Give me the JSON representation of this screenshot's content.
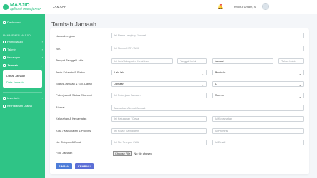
{
  "brand": {
    "name": "MASJID",
    "subtitle": "aplikasi manajemen"
  },
  "sidebar": {
    "dashboard": "Dashboard",
    "section_label": "MANAJEMEN MASJID",
    "items": [
      {
        "label": "Profil Masjid"
      },
      {
        "label": "Takmir"
      },
      {
        "label": "Keuangan"
      },
      {
        "label": "Jamaah"
      }
    ],
    "submenu": [
      {
        "label": "Daftar Jamaah"
      },
      {
        "label": "Data Jamaah"
      }
    ],
    "bottom_items": [
      {
        "label": "Inventaris"
      },
      {
        "label": "Ke Halaman Utama"
      }
    ]
  },
  "topbar": {
    "title": "JAMAAH",
    "user": "Khoirul Umam, S."
  },
  "page": {
    "title": "Tambah Jamaah"
  },
  "form": {
    "nama_label": "Nama Lengkap",
    "nama_placeholder": "Isi Nama Lengkap Jamaah",
    "nik_label": "NIK",
    "nik_placeholder": "Isi Nomor KTP / NIK",
    "ttl_label": "Tempat Tanggal Lahir",
    "ttl_tempat_placeholder": "Isi Kab/Kabupaten Kelahiran",
    "ttl_tanggal_placeholder": "Tanggal Lahir",
    "ttl_bulan_value": "Januari",
    "ttl_tahun_placeholder": "Tahun Lahir",
    "jk_label": "Jenis Kelamin & Status",
    "jk_value": "Laki-laki",
    "status_value": "Menikah",
    "sj_label": "Status Jamaah & Gol. Darah",
    "sj_value": "Jamaah",
    "darah_value": "A",
    "pek_label": "Pekerjaan & Status Ekonomi",
    "pek_placeholder": "Isi Pekerjaan Jamaah",
    "ekonomi_value": "Mampu",
    "alamat_label": "Alamat",
    "alamat_placeholder": "Masukkan Alamat Jamaah",
    "kel_label": "Kelurahan & Kecamatan",
    "kel_placeholder": "Isi Kelurahan / Desa",
    "kec_placeholder": "Isi Kecamatan",
    "kota_label": "Kota / Kabupaten & Provinsi",
    "kota_placeholder": "Isi Kota / Kabupaten",
    "prov_placeholder": "Isi Provinsi",
    "telp_label": "No. Telepon & Email",
    "telp_placeholder": "Isi No. Telepon / WA",
    "email_placeholder": "Isi Email",
    "foto_label": "Foto Jamaah",
    "file_button": "Choose File",
    "file_status": "No file chosen",
    "save_button": "SIMPAN",
    "back_button": "KEMBALI"
  },
  "colors": {
    "sidebar": "#2fc486",
    "primary": "#4e7dd9"
  }
}
